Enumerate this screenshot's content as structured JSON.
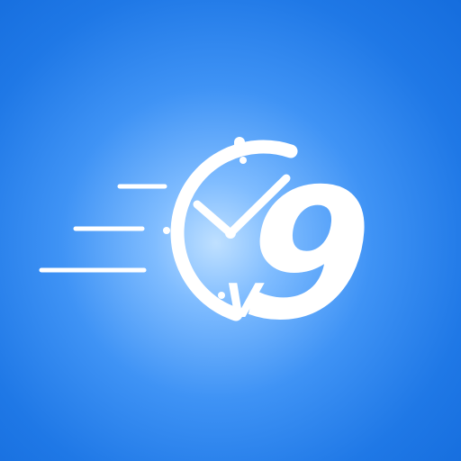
{
  "logo": {
    "letter": "V",
    "number": "9",
    "icon": "stopwatch-icon",
    "colors": {
      "background_center": "#bfe0ff",
      "background_edge": "#156ddd",
      "mark": "#ffffff"
    }
  }
}
